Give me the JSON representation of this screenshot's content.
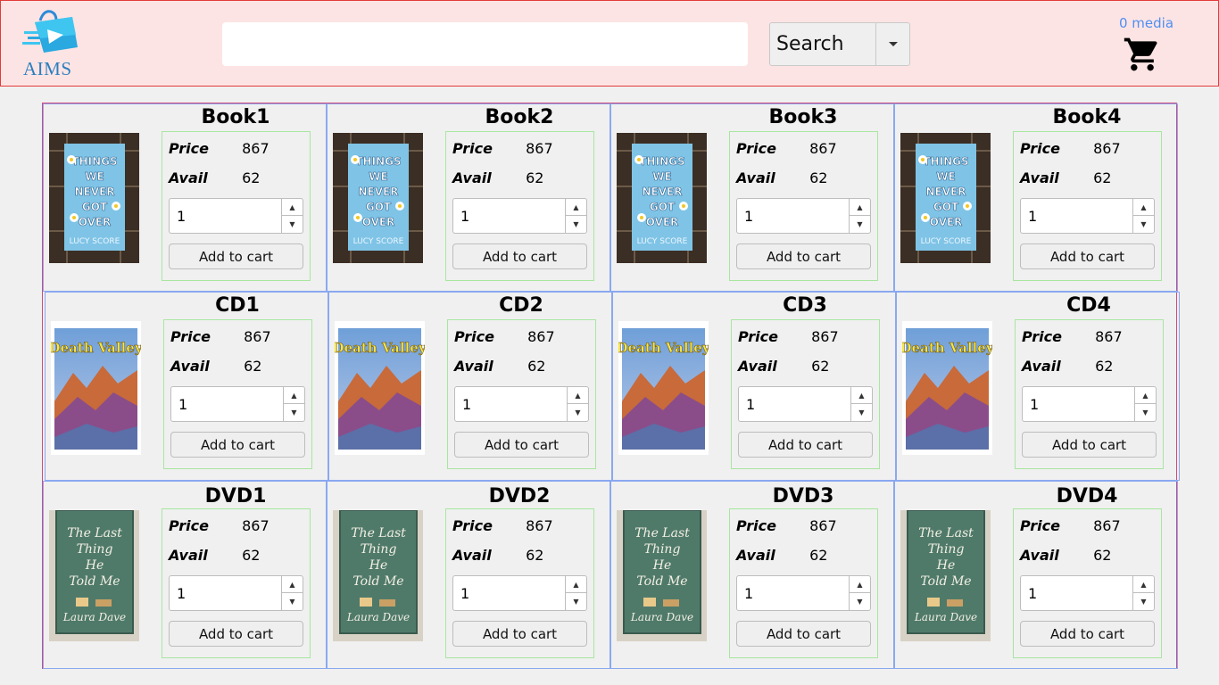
{
  "header": {
    "logo_text": "AIMS",
    "search_value": "",
    "search_button_label": "Search",
    "media_count": "0 media"
  },
  "labels": {
    "price": "Price",
    "avail": "Avail",
    "add_to_cart": "Add to cart"
  },
  "products": [
    {
      "title": "Book1",
      "price": "867",
      "avail": "62",
      "qty": "1",
      "cover": "book"
    },
    {
      "title": "Book2",
      "price": "867",
      "avail": "62",
      "qty": "1",
      "cover": "book"
    },
    {
      "title": "Book3",
      "price": "867",
      "avail": "62",
      "qty": "1",
      "cover": "book"
    },
    {
      "title": "Book4",
      "price": "867",
      "avail": "62",
      "qty": "1",
      "cover": "book"
    },
    {
      "title": "CD1",
      "price": "867",
      "avail": "62",
      "qty": "1",
      "cover": "cd"
    },
    {
      "title": "CD2",
      "price": "867",
      "avail": "62",
      "qty": "1",
      "cover": "cd"
    },
    {
      "title": "CD3",
      "price": "867",
      "avail": "62",
      "qty": "1",
      "cover": "cd"
    },
    {
      "title": "CD4",
      "price": "867",
      "avail": "62",
      "qty": "1",
      "cover": "cd"
    },
    {
      "title": "DVD1",
      "price": "867",
      "avail": "62",
      "qty": "1",
      "cover": "dvd"
    },
    {
      "title": "DVD2",
      "price": "867",
      "avail": "62",
      "qty": "1",
      "cover": "dvd"
    },
    {
      "title": "DVD3",
      "price": "867",
      "avail": "62",
      "qty": "1",
      "cover": "dvd"
    },
    {
      "title": "DVD4",
      "price": "867",
      "avail": "62",
      "qty": "1",
      "cover": "dvd"
    }
  ],
  "covers": {
    "book": {
      "line1": "THINGS",
      "line2": "WE",
      "line3": "NEVER",
      "line4": "GOT",
      "line5": "OVER",
      "author": "LUCY SCORE"
    },
    "cd": {
      "title": "Death Valley"
    },
    "dvd": {
      "line1": "The Last",
      "line2": "Thing",
      "line3": "He",
      "line4": "Told Me",
      "author": "Laura Dave"
    }
  },
  "colors": {
    "header_bg": "#fde4e4",
    "accent": "#4e8ff3",
    "card_border": "#8aa8f0",
    "panel_border": "#a8e6a0"
  }
}
